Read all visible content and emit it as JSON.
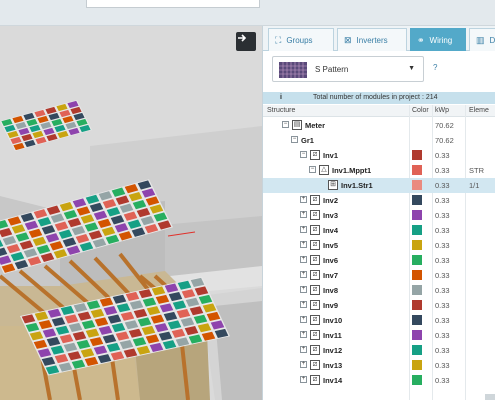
{
  "tabs": [
    {
      "label": "Groups",
      "icon": "groups-icon",
      "active": false
    },
    {
      "label": "Inverters",
      "icon": "inverter-icon",
      "active": false
    },
    {
      "label": "Wiring",
      "icon": "wiring-icon",
      "active": true
    },
    {
      "label": "D",
      "icon": "data-icon",
      "active": false
    }
  ],
  "pattern_selector": {
    "value": "S Pattern",
    "help": "?"
  },
  "info": {
    "icon": "i",
    "text": "Total number of modules in project : 214"
  },
  "table": {
    "headers": {
      "structure": "Structure",
      "color": "Color",
      "kwp": "kWp",
      "element": "Eleme"
    },
    "rows": [
      {
        "name": "Meter",
        "kwp": "70.62",
        "element": "",
        "color": "",
        "icon": "meter-icon",
        "toggle": "⊟",
        "level": 0
      },
      {
        "name": "Gr1",
        "kwp": "70.62",
        "element": "",
        "color": "",
        "icon": "",
        "toggle": "⊟",
        "level": 1
      },
      {
        "name": "Inv1",
        "kwp": "0.33",
        "element": "",
        "color": "#b03a2e",
        "icon": "inverter-icon",
        "toggle": "⊟",
        "level": 2
      },
      {
        "name": "Inv1.Mppt1",
        "kwp": "0.33",
        "element": "STR",
        "color": "#e06256",
        "icon": "mppt-icon",
        "toggle": "⊟",
        "level": 3
      },
      {
        "name": "Inv1.Str1",
        "kwp": "0.33",
        "element": "1/1",
        "color": "#ea8a7f",
        "icon": "string-icon",
        "toggle": "",
        "level": 4,
        "selected": true
      },
      {
        "name": "Inv2",
        "kwp": "0.33",
        "element": "",
        "color": "#34495e",
        "icon": "inverter-icon",
        "toggle": "⊞",
        "level": 2
      },
      {
        "name": "Inv3",
        "kwp": "0.33",
        "element": "",
        "color": "#8e44ad",
        "icon": "inverter-icon",
        "toggle": "⊞",
        "level": 2
      },
      {
        "name": "Inv4",
        "kwp": "0.33",
        "element": "",
        "color": "#16a085",
        "icon": "inverter-icon",
        "toggle": "⊞",
        "level": 2
      },
      {
        "name": "Inv5",
        "kwp": "0.33",
        "element": "",
        "color": "#c9a410",
        "icon": "inverter-icon",
        "toggle": "⊞",
        "level": 2
      },
      {
        "name": "Inv6",
        "kwp": "0.33",
        "element": "",
        "color": "#27ae60",
        "icon": "inverter-icon",
        "toggle": "⊞",
        "level": 2
      },
      {
        "name": "Inv7",
        "kwp": "0.33",
        "element": "",
        "color": "#d35400",
        "icon": "inverter-icon",
        "toggle": "⊞",
        "level": 2
      },
      {
        "name": "Inv8",
        "kwp": "0.33",
        "element": "",
        "color": "#95a5a6",
        "icon": "inverter-icon",
        "toggle": "⊞",
        "level": 2
      },
      {
        "name": "Inv9",
        "kwp": "0.33",
        "element": "",
        "color": "#b03a2e",
        "icon": "inverter-icon",
        "toggle": "⊞",
        "level": 2
      },
      {
        "name": "Inv10",
        "kwp": "0.33",
        "element": "",
        "color": "#34495e",
        "icon": "inverter-icon",
        "toggle": "⊞",
        "level": 2
      },
      {
        "name": "Inv11",
        "kwp": "0.33",
        "element": "",
        "color": "#8e44ad",
        "icon": "inverter-icon",
        "toggle": "⊞",
        "level": 2
      },
      {
        "name": "Inv12",
        "kwp": "0.33",
        "element": "",
        "color": "#16a085",
        "icon": "inverter-icon",
        "toggle": "⊞",
        "level": 2
      },
      {
        "name": "Inv13",
        "kwp": "0.33",
        "element": "",
        "color": "#c9a410",
        "icon": "inverter-icon",
        "toggle": "⊞",
        "level": 2
      },
      {
        "name": "Inv14",
        "kwp": "0.33",
        "element": "",
        "color": "#27ae60",
        "icon": "inverter-icon",
        "toggle": "⊞",
        "level": 2
      }
    ]
  },
  "module_palette": [
    "#b03a2e",
    "#34495e",
    "#8e44ad",
    "#16a085",
    "#c9a410",
    "#27ae60",
    "#d35400",
    "#95a5a6",
    "#e06256"
  ]
}
